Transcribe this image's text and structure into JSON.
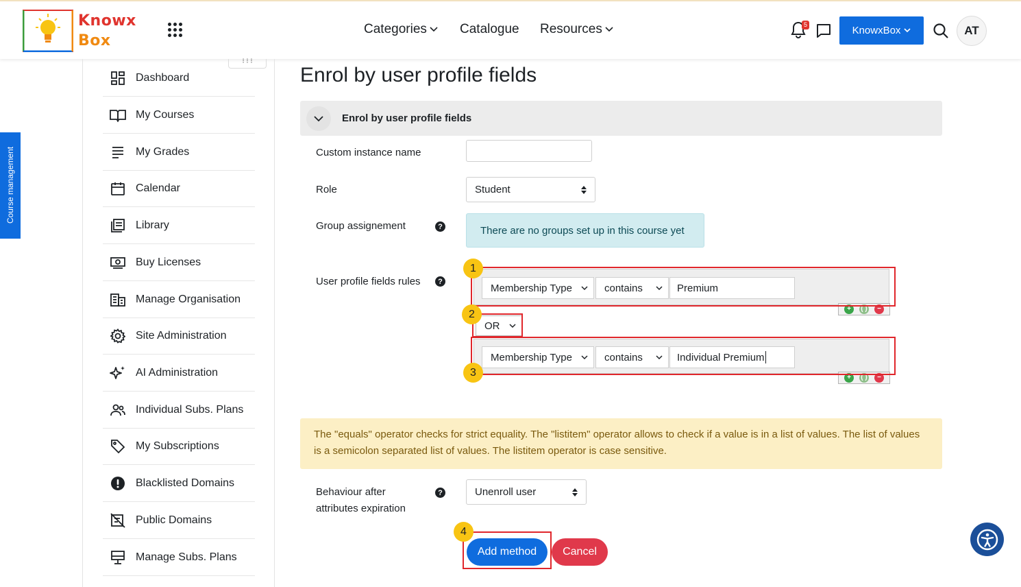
{
  "header": {
    "brand_line1": "Knowx",
    "brand_line2": "Box",
    "nav": {
      "categories": "Categories",
      "catalogue": "Catalogue",
      "resources": "Resources"
    },
    "notification_count": "5",
    "user_menu_label": "KnowxBox",
    "avatar_initials": "AT"
  },
  "side_tab": "Course management",
  "sidebar": {
    "items": [
      {
        "label": "Dashboard",
        "icon": "dashboard-icon"
      },
      {
        "label": "My Courses",
        "icon": "book-icon"
      },
      {
        "label": "My Grades",
        "icon": "grades-icon"
      },
      {
        "label": "Calendar",
        "icon": "calendar-icon"
      },
      {
        "label": "Library",
        "icon": "library-icon"
      },
      {
        "label": "Buy Licenses",
        "icon": "license-icon"
      },
      {
        "label": "Manage Organisation",
        "icon": "building-icon"
      },
      {
        "label": "Site Administration",
        "icon": "gear-icon"
      },
      {
        "label": "AI Administration",
        "icon": "sparkle-icon"
      },
      {
        "label": "Individual Subs. Plans",
        "icon": "users-icon"
      },
      {
        "label": "My Subscriptions",
        "icon": "tag-icon"
      },
      {
        "label": "Blacklisted Domains",
        "icon": "alert-icon"
      },
      {
        "label": "Public Domains",
        "icon": "public-domains-icon"
      },
      {
        "label": "Manage Subs. Plans",
        "icon": "monitor-icon"
      }
    ]
  },
  "page": {
    "title": "Enrol by user profile fields",
    "section_title": "Enrol by user profile fields"
  },
  "form": {
    "custom_instance_name": {
      "label": "Custom instance name",
      "value": ""
    },
    "role": {
      "label": "Role",
      "value": "Student"
    },
    "group": {
      "label": "Group assignement",
      "info": "There are no groups set up in this course yet"
    },
    "rules": {
      "label": "User profile fields rules",
      "rule1": {
        "field": "Membership Type",
        "operator": "contains",
        "value": "Premium"
      },
      "connector": "OR",
      "rule2": {
        "field": "Membership Type",
        "operator": "contains",
        "value": "Individual Premium"
      }
    },
    "warning": "The \"equals\" operator checks for strict equality. The \"listitem\" operator allows to check if a value is in a list of values. The list of values is a semicolon separated list of values. The listitem operator is case sensitive.",
    "behaviour": {
      "label_line1": "Behaviour after",
      "label_line2": "attributes expiration",
      "value": "Unenroll user"
    },
    "submit": "Add method",
    "cancel": "Cancel"
  },
  "annotations": {
    "m1": "1",
    "m2": "2",
    "m3": "3",
    "m4": "4"
  },
  "colors": {
    "primary": "#0f6cde",
    "danger": "#e0394b",
    "annotation_box": "#e0262b",
    "annotation_marker": "#f8c413",
    "info_bg": "#d2ecf0",
    "warning_bg": "#fcefc5"
  }
}
